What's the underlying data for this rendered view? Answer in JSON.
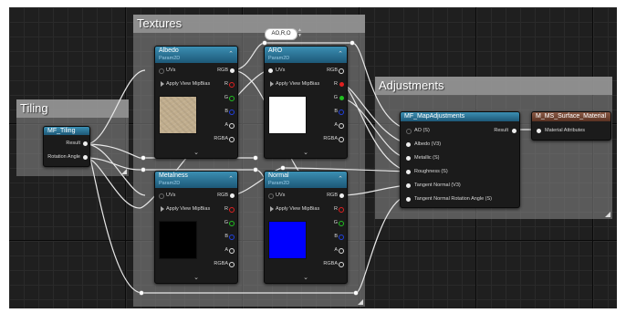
{
  "comments": {
    "textures": "Textures",
    "tiling": "Tiling",
    "adjustments": "Adjustments"
  },
  "reroute_label": "AO,R,O",
  "tiling_node": {
    "title": "MF_Tiling",
    "outputs": [
      "Result",
      "Rotation Angle"
    ]
  },
  "albedo": {
    "title": "Albedo",
    "subtitle": "Param2D",
    "uvs": "UVs",
    "mip": "Apply View MipBias",
    "outs": [
      "RGB",
      "R",
      "G",
      "B",
      "A",
      "RGBA"
    ],
    "preview_color": "#c1ae8e"
  },
  "aro": {
    "title": "ARO",
    "subtitle": "Param2D",
    "uvs": "UVs",
    "mip": "Apply View MipBias",
    "outs": [
      "RGB",
      "R",
      "G",
      "B",
      "A",
      "RGBA"
    ],
    "preview_color": "#ffffff"
  },
  "metalness": {
    "title": "Metalness",
    "subtitle": "Param2D",
    "uvs": "UVs",
    "mip": "Apply View MipBias",
    "outs": [
      "RGB",
      "R",
      "G",
      "B",
      "A",
      "RGBA"
    ],
    "preview_color": "#000000"
  },
  "normal": {
    "title": "Normal",
    "subtitle": "Param2D",
    "uvs": "UVs",
    "mip": "Apply View MipBias",
    "outs": [
      "RGB",
      "R",
      "G",
      "B",
      "A",
      "RGBA"
    ],
    "preview_color": "#0000ff"
  },
  "map_adjust": {
    "title": "MF_MapAdjustments",
    "result": "Result",
    "inputs": [
      "AO (S)",
      "Albedo (V3)",
      "Metallic (S)",
      "Roughness (S)",
      "Tangent Normal (V3)",
      "Tangent Normal Rotation Angle (S)"
    ]
  },
  "material": {
    "title": "M_MS_Surface_Material",
    "input": "Material Attributes"
  },
  "pin_colors": {
    "r": "#e02020",
    "g": "#20c020",
    "b": "#2040e0",
    "white": "#eeeeee"
  }
}
